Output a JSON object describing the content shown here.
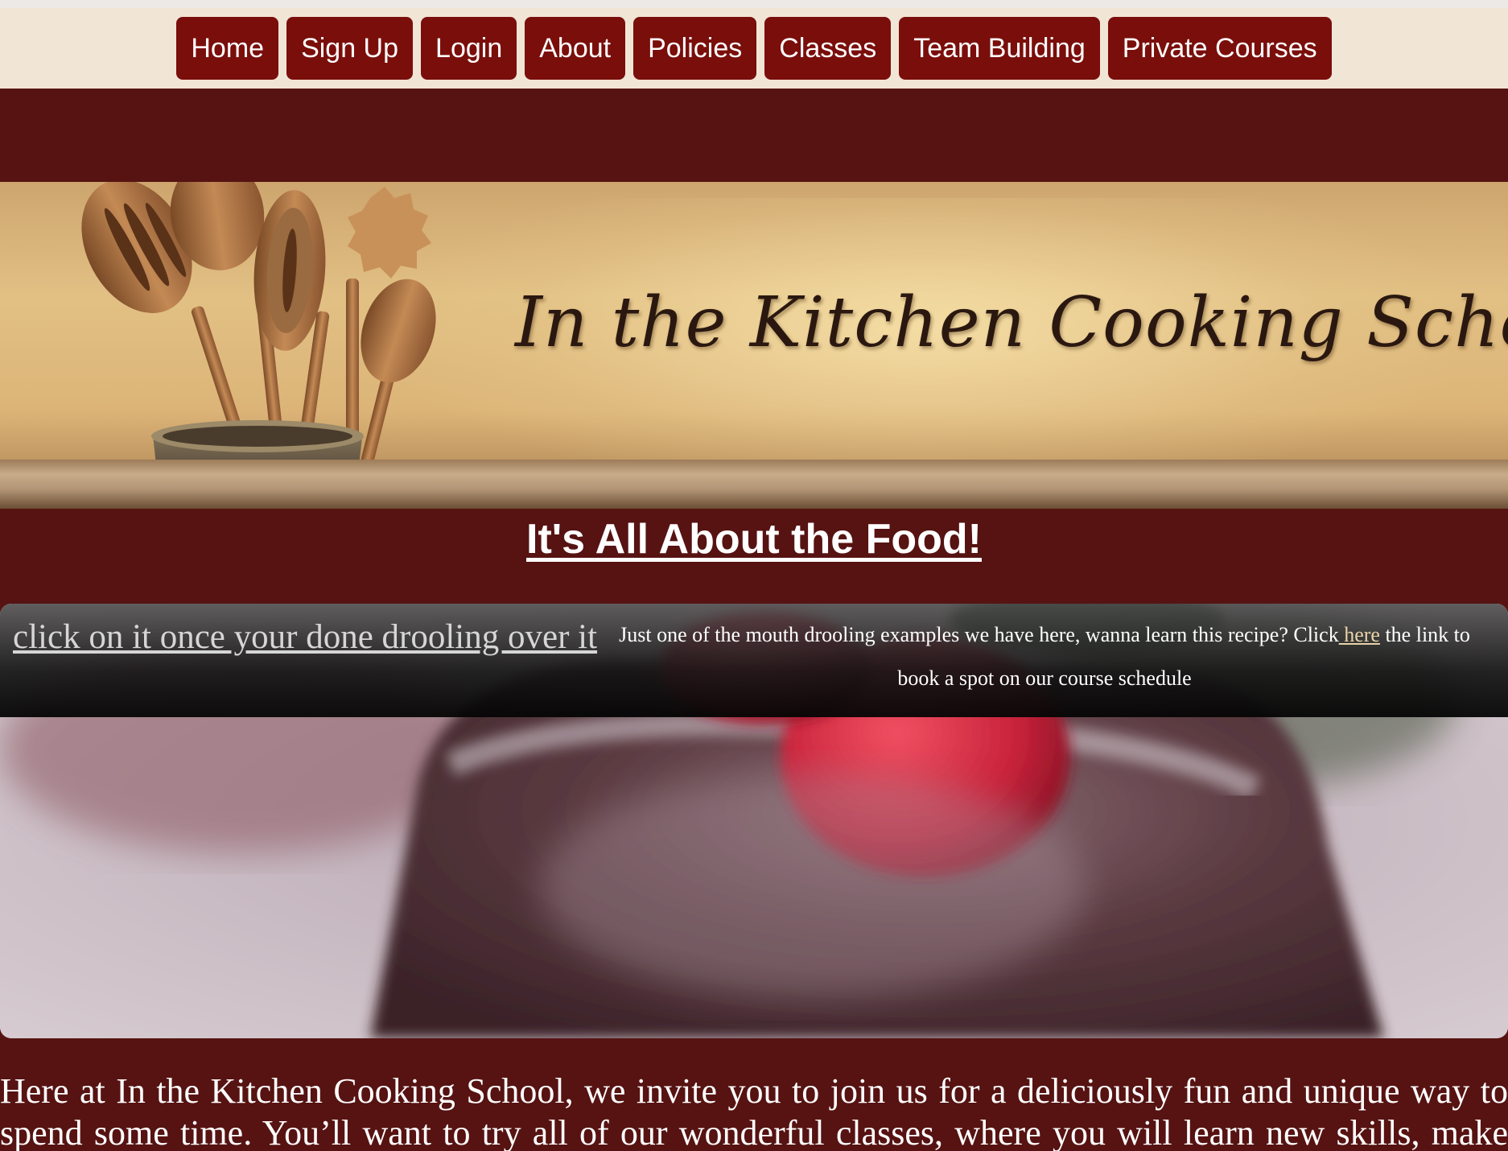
{
  "nav": {
    "items": [
      {
        "label": "Home"
      },
      {
        "label": "Sign Up"
      },
      {
        "label": "Login"
      },
      {
        "label": "About"
      },
      {
        "label": "Policies"
      },
      {
        "label": "Classes"
      },
      {
        "label": "Team Building"
      },
      {
        "label": "Private Courses"
      }
    ]
  },
  "banner": {
    "title": "In the Kitchen Cooking School"
  },
  "main": {
    "heading": "It's All About the Food!",
    "slide": {
      "link_text": "click on it once your done drooling over it",
      "caption_before": "Just one of the mouth drooling examples we have here, wanna learn this recipe? Click",
      "caption_link": " here",
      "caption_after": " the link to book a spot on our course schedule"
    },
    "intro_line1": "Here at In the Kitchen Cooking School, we invite you to join us for a deliciously fun and unique way to",
    "intro_line2": "spend some time. You’ll want to try all of our wonderful classes, where you will learn new skills, make"
  },
  "colors": {
    "nav_background": "#f1e5d6",
    "nav_button": "#7a0e0b",
    "page_background": "#561312",
    "link_accent": "#e8d3a8"
  }
}
